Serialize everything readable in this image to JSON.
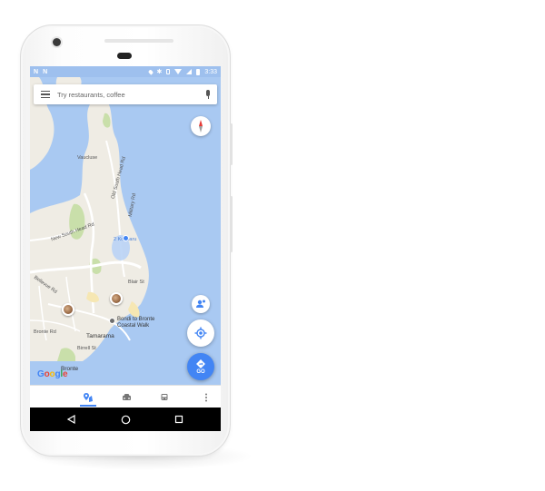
{
  "status_bar": {
    "left_icons": [
      "N",
      "N"
    ],
    "right_icons": [
      "location-icon",
      "bluetooth-icon",
      "vibrate-icon",
      "wifi-icon",
      "signal-icon",
      "battery-icon"
    ],
    "time": "3:33"
  },
  "search": {
    "placeholder": "Try restaurants, coffee"
  },
  "map": {
    "labels": {
      "vaucluse": "Vaucluse",
      "new_south_head_rd": "New South Head Rd",
      "old_south_head_rd": "Old South Head Rd",
      "military_rd": "Military Rd",
      "kooparu": "2 Kooparu",
      "bellevue_rd": "Bellevue Rd",
      "blair_st": "Blair St",
      "tamarama": "Tamarama",
      "bronte": "Bronte",
      "bondi_walk": "Bondi to Bronte\nCoastal Walk",
      "birrell_st": "Birrell St",
      "bronte_rd": "Bronte Rd"
    },
    "logo": "Google"
  },
  "buttons": {
    "go_label": "GO"
  },
  "bottom_nav": {
    "items": [
      "explore-icon",
      "driving-icon",
      "transit-icon",
      "more-icon"
    ],
    "active": "explore-icon"
  },
  "colors": {
    "water": "#a9c9f2",
    "land": "#efece4",
    "park": "#c9dfaa",
    "accent": "#4285f4"
  }
}
